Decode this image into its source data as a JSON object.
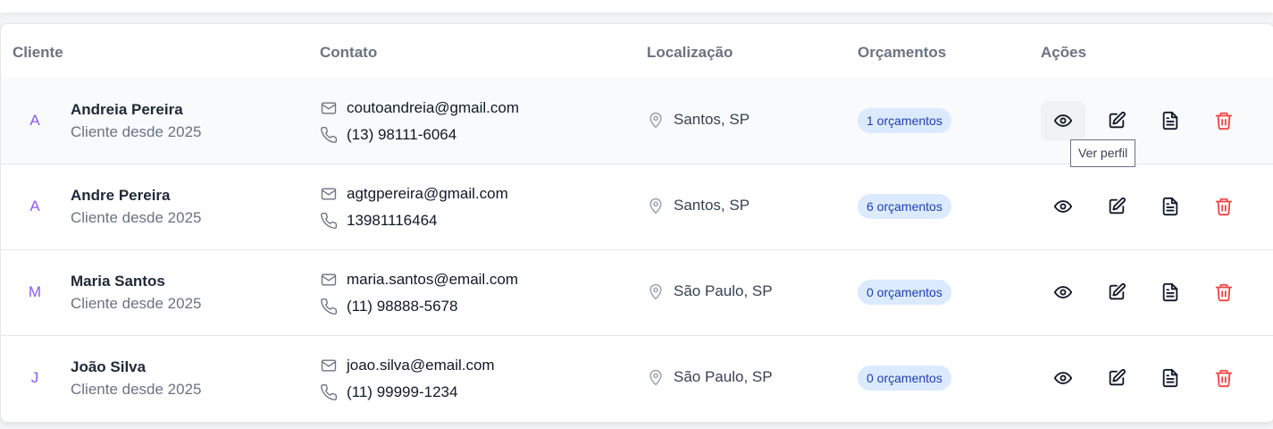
{
  "headers": {
    "cliente": "Cliente",
    "contato": "Contato",
    "localizacao": "Localização",
    "orcamentos": "Orçamentos",
    "acoes": "Ações"
  },
  "rows": [
    {
      "initial": "A",
      "name": "Andreia Pereira",
      "since": "Cliente desde 2025",
      "email": "coutoandreia@gmail.com",
      "phone": "(13) 98111-6064",
      "location": "Santos, SP",
      "budgets": "1 orçamentos"
    },
    {
      "initial": "A",
      "name": "Andre Pereira",
      "since": "Cliente desde 2025",
      "email": "agtgpereira@gmail.com",
      "phone": "13981116464",
      "location": "Santos, SP",
      "budgets": "6 orçamentos"
    },
    {
      "initial": "M",
      "name": "Maria Santos",
      "since": "Cliente desde 2025",
      "email": "maria.santos@email.com",
      "phone": "(11) 98888-5678",
      "location": "São Paulo, SP",
      "budgets": "0 orçamentos"
    },
    {
      "initial": "J",
      "name": "João Silva",
      "since": "Cliente desde 2025",
      "email": "joao.silva@email.com",
      "phone": "(11) 99999-1234",
      "location": "São Paulo, SP",
      "budgets": "0 orçamentos"
    }
  ],
  "icons": {
    "view": "eye-icon",
    "edit": "edit-icon",
    "document": "document-icon",
    "delete": "trash-icon",
    "email": "mail-icon",
    "phone": "phone-icon",
    "location": "map-pin-icon"
  },
  "colors": {
    "avatar_text": "#8b5cf6",
    "badge_bg": "#dbeafe",
    "badge_text": "#1e40af",
    "delete": "#ef4444",
    "row_hover": "#f9fafb"
  },
  "tooltip": "Ver perfil"
}
